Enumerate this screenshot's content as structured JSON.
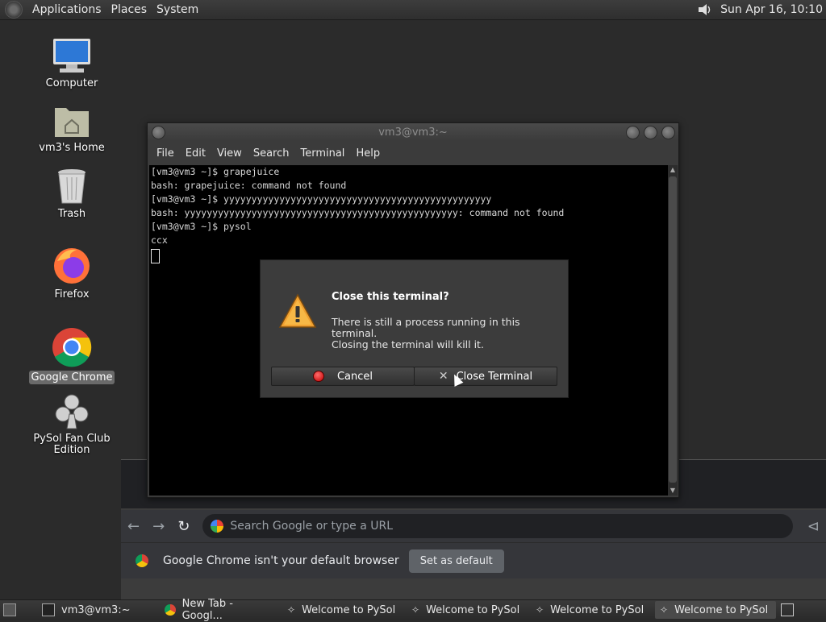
{
  "top_panel": {
    "menus": [
      "Applications",
      "Places",
      "System"
    ],
    "clock": "Sun Apr 16, 10:10"
  },
  "desktop_icons": [
    {
      "label": "Computer",
      "icon": "computer-icon"
    },
    {
      "label": "vm3's Home",
      "icon": "home-folder-icon"
    },
    {
      "label": "Trash",
      "icon": "trash-icon"
    },
    {
      "label": "Firefox",
      "icon": "firefox-icon"
    },
    {
      "label": "Google Chrome",
      "icon": "chrome-icon",
      "selected": true
    },
    {
      "label": "PySol Fan Club\nEdition",
      "icon": "pysol-club-icon"
    }
  ],
  "terminal": {
    "title": "vm3@vm3:~",
    "menu": [
      "File",
      "Edit",
      "View",
      "Search",
      "Terminal",
      "Help"
    ],
    "lines": [
      "[vm3@vm3 ~]$ grapejuice",
      "bash: grapejuice: command not found",
      "[vm3@vm3 ~]$ yyyyyyyyyyyyyyyyyyyyyyyyyyyyyyyyyyyyyyyyyyyyyyyy",
      "bash: yyyyyyyyyyyyyyyyyyyyyyyyyyyyyyyyyyyyyyyyyyyyyyyyy: command not found",
      "[vm3@vm3 ~]$ pysol",
      "ccx"
    ]
  },
  "dialog": {
    "title": "Close this terminal?",
    "line1": "There is still a process running in this terminal.",
    "line2": "Closing the terminal will kill it.",
    "cancel": "Cancel",
    "close": "Close Terminal"
  },
  "chrome": {
    "omnibox_placeholder": "Search Google or type a URL",
    "infobar_text": "Google Chrome isn't your default browser",
    "set_default": "Set as default"
  },
  "taskbar": {
    "items": [
      {
        "label": "vm3@vm3:~",
        "icon": "terminal-icon"
      },
      {
        "label": "New Tab - Googl...",
        "icon": "chrome-icon"
      },
      {
        "label": "Welcome to PySol",
        "icon": "pysol-icon"
      },
      {
        "label": "Welcome to PySol",
        "icon": "pysol-icon"
      },
      {
        "label": "Welcome to PySol",
        "icon": "pysol-icon"
      },
      {
        "label": "Welcome to PySol",
        "icon": "pysol-icon",
        "active": true
      }
    ]
  }
}
